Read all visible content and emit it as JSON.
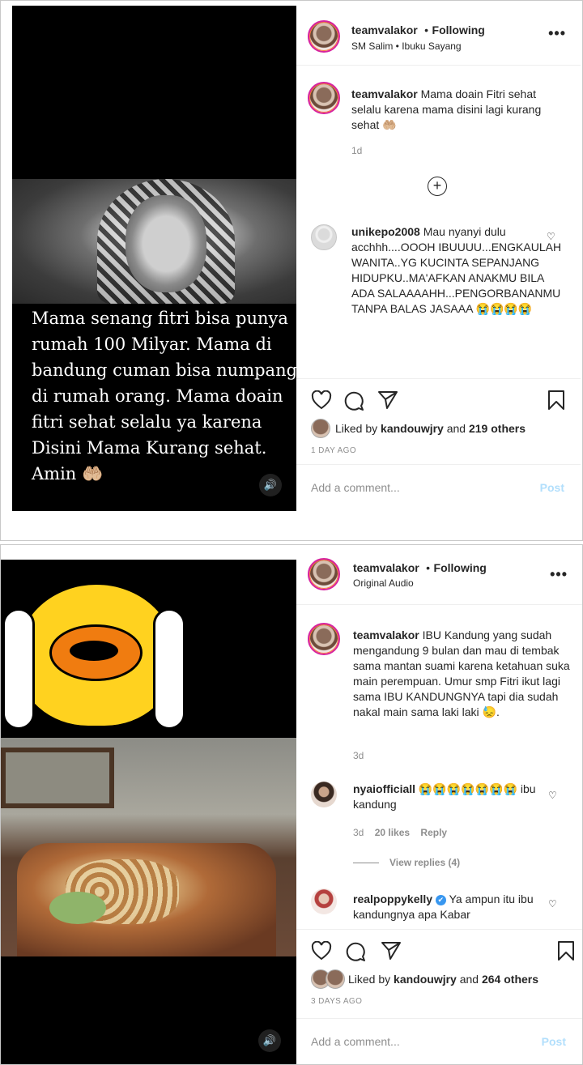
{
  "post1": {
    "media": {
      "overlay_text": "Mama senang fitri bisa punya rumah 100 Milyar. Mama di bandung cuman bisa numpang di rumah orang. Mama doain fitri sehat selalu ya karena Disini Mama Kurang sehat. Amin 🤲🏼"
    },
    "header": {
      "username": "teamvalakor",
      "separator": "•",
      "follow": "Following",
      "subline": "SM Salim • Ibuku Sayang"
    },
    "caption": {
      "username": "teamvalakor",
      "text": "Mama doain Fitri sehat selalu karena mama disini lagi kurang sehat 🤲🏼",
      "time": "1d"
    },
    "load_more_symbol": "+",
    "comments": [
      {
        "username": "unikepo2008",
        "text": "Mau nyanyi dulu acchhh....OOOH IBUUUU...ENGKAULAH WANITA..YG KUCINTA SEPANJANG HIDUPKU..MA'AFKAN ANAKMU BILA ADA SALAAAAHH...PENGORBANANMU TANPA BALAS JASAAA 😭😭😭😭"
      }
    ],
    "likes": {
      "prefix": "Liked by",
      "user": "kandouwjry",
      "and": "and",
      "others": "219 others"
    },
    "timestamp": "1 DAY AGO",
    "comment_placeholder": "Add a comment...",
    "post_label": "Post"
  },
  "post2": {
    "header": {
      "username": "teamvalakor",
      "separator": "•",
      "follow": "Following",
      "subline": "Original Audio"
    },
    "caption": {
      "username": "teamvalakor",
      "text": "IBU Kandung yang sudah mengandung 9 bulan dan mau di tembak sama mantan suami karena ketahuan suka main perempuan. Umur smp Fitri ikut lagi sama IBU KANDUNGNYA tapi dia sudah nakal main sama laki laki 😓.",
      "time": "3d"
    },
    "comments": [
      {
        "username": "nyaiofficiall",
        "text": "😭😭😭😭😭😭😭 ibu kandung",
        "time": "3d",
        "likes": "20 likes",
        "reply": "Reply",
        "view_replies": "View replies (4)"
      },
      {
        "username": "realpoppykelly",
        "verified": "✔",
        "text": "Ya ampun itu ibu kandungnya apa Kabar"
      }
    ],
    "likes": {
      "prefix": "Liked by",
      "user": "kandouwjry",
      "and": "and",
      "others": "264 others"
    },
    "timestamp": "3 DAYS AGO",
    "comment_placeholder": "Add a comment...",
    "post_label": "Post"
  },
  "icons": {
    "volume": "🔊",
    "more": "•••",
    "heart_small": "♡"
  }
}
